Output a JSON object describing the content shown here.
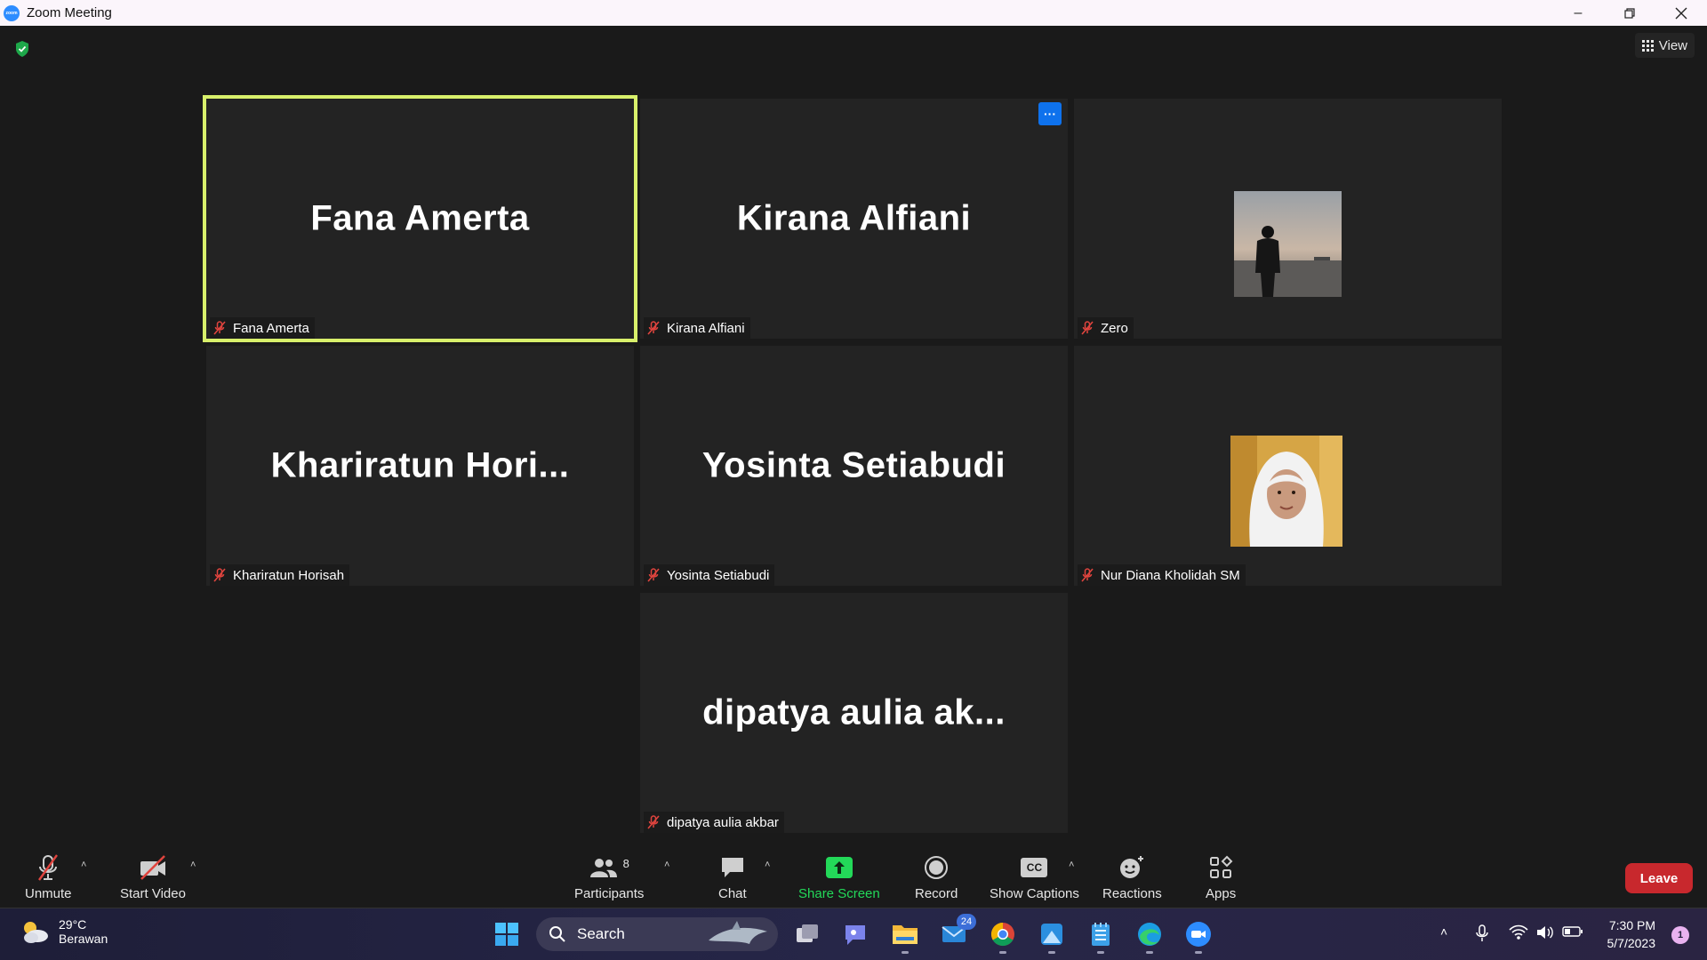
{
  "window": {
    "title": "Zoom Meeting"
  },
  "meeting": {
    "view_label": "View",
    "tiles": [
      {
        "big_name": "Fana Amerta",
        "label": "Fana Amerta",
        "active": true,
        "avatar": null
      },
      {
        "big_name": "Kirana Alfiani",
        "label": "Kirana Alfiani",
        "active": false,
        "avatar": null,
        "more_menu": "···"
      },
      {
        "big_name": "",
        "label": "Zero",
        "active": false,
        "avatar": "silhouette-photo"
      },
      {
        "big_name": "Khariratun  Hori...",
        "label": "Khariratun Horisah",
        "active": false,
        "avatar": null
      },
      {
        "big_name": "Yosinta Setiabudi",
        "label": "Yosinta Setiabudi",
        "active": false,
        "avatar": null
      },
      {
        "big_name": "",
        "label": "Nur Diana Kholidah SM",
        "active": false,
        "avatar": "hijab-photo"
      },
      {
        "big_name": "dipatya  aulia  ak...",
        "label": "dipatya aulia akbar",
        "active": false,
        "avatar": null
      }
    ]
  },
  "toolbar": {
    "unmute": "Unmute",
    "start_video": "Start Video",
    "participants": "Participants",
    "participants_count": "8",
    "chat": "Chat",
    "share_screen": "Share Screen",
    "record": "Record",
    "show_captions": "Show Captions",
    "captions_icon_text": "CC",
    "reactions": "Reactions",
    "apps": "Apps",
    "leave": "Leave"
  },
  "taskbar": {
    "weather_temp": "29°C",
    "weather_cond": "Berawan",
    "search_label": "Search",
    "mail_badge": "24",
    "time": "7:30 PM",
    "date": "5/7/2023",
    "notification_count": "1"
  },
  "colors": {
    "active_speaker_border": "#d8f06b",
    "share_screen_green": "#23d959",
    "leave_red": "#c8282d",
    "muted_red": "#e0443e"
  }
}
